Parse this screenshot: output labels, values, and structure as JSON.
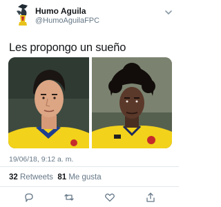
{
  "user": {
    "name": "Humo Aguila",
    "handle": "@HumoAguilaFPC"
  },
  "tweet": {
    "text": "Les propongo un sueño",
    "timestamp": "19/06/18, 9:12 a. m."
  },
  "stats": {
    "retweets_count": "32",
    "retweets_label": "Retweets",
    "likes_count": "81",
    "likes_label": "Me gusta"
  },
  "icons": {
    "menu": "chevron-down-icon",
    "reply": "reply-icon",
    "retweet": "retweet-icon",
    "like": "heart-icon",
    "share": "share-icon"
  },
  "colors": {
    "secondary_text": "#657786",
    "divider": "#e1e8ed",
    "shirt_yellow": "#f2d21b"
  }
}
